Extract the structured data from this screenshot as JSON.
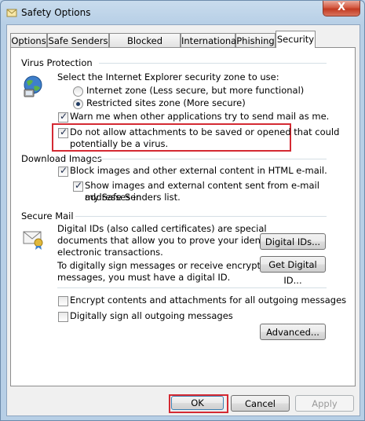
{
  "window": {
    "title": "Safety Options",
    "close_symbol": "X"
  },
  "tabs": [
    {
      "label": "Options"
    },
    {
      "label": "Safe Senders"
    },
    {
      "label": "Blocked Senders"
    },
    {
      "label": "International"
    },
    {
      "label": "Phishing"
    },
    {
      "label": "Security",
      "active": true
    }
  ],
  "virus": {
    "heading": "Virus Protection",
    "zone_prompt": "Select the Internet Explorer security zone to use:",
    "zone_internet": "Internet zone (Less secure, but more functional)",
    "zone_restricted": "Restricted sites zone (More secure)",
    "zone_selected": "restricted",
    "warn_label": "Warn me when other applications try to send mail as me.",
    "warn_checked": true,
    "attach_line1": "Do not allow attachments to be saved or opened that could",
    "attach_line2": "potentially be a virus.",
    "attach_checked": true
  },
  "download": {
    "heading": "Download Images",
    "block_label": "Block images and other external content in HTML e-mail.",
    "block_checked": true,
    "show_line1": "Show images and external content sent from e-mail addresses in",
    "show_line2": "my Safe Senders list.",
    "show_checked": true
  },
  "secure": {
    "heading": "Secure Mail",
    "ids_line1": "Digital IDs (also called certificates) are special",
    "ids_line2": "documents that allow you to prove your identity in",
    "ids_line3": "electronic transactions.",
    "sign_line1": "To digitally sign messages or receive encrypted",
    "sign_line2": "messages, you must have a digital ID.",
    "digital_ids_button": "Digital IDs...",
    "get_id_button": "Get Digital ID...",
    "encrypt_label": "Encrypt contents and attachments for all outgoing messages",
    "encrypt_checked": false,
    "sign_label": "Digitally sign all outgoing messages",
    "sign_checked": false,
    "advanced_button": "Advanced..."
  },
  "footer": {
    "ok": "OK",
    "cancel": "Cancel",
    "apply": "Apply"
  },
  "colors": {
    "highlight_box": "#d42a33",
    "check": "#1a2a4c"
  }
}
